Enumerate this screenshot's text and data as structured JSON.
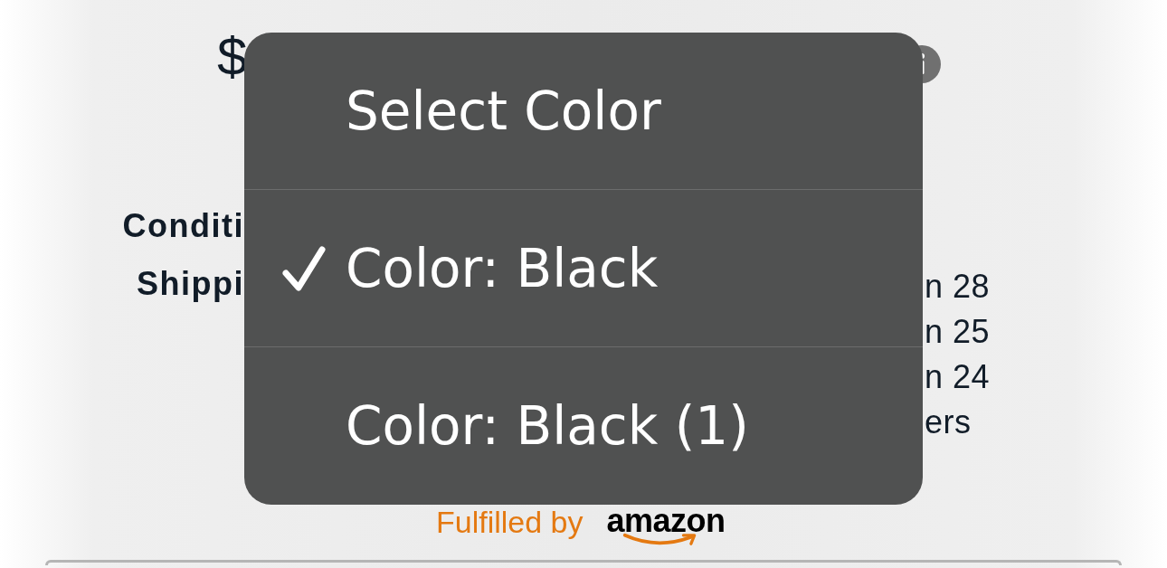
{
  "price": {
    "currency_symbol": "$"
  },
  "details": {
    "labels": [
      "Conditi",
      "Shippi"
    ],
    "values": [
      "n 28",
      "n 25",
      "n 24",
      "ers"
    ]
  },
  "fulfillment": {
    "text": "Fulfilled by",
    "logo_text": "amazon"
  },
  "color_menu": {
    "options": [
      {
        "label": "Select Color",
        "selected": false
      },
      {
        "label": "Color: Black",
        "selected": true
      },
      {
        "label": "Color: Black (1)",
        "selected": false
      }
    ]
  }
}
